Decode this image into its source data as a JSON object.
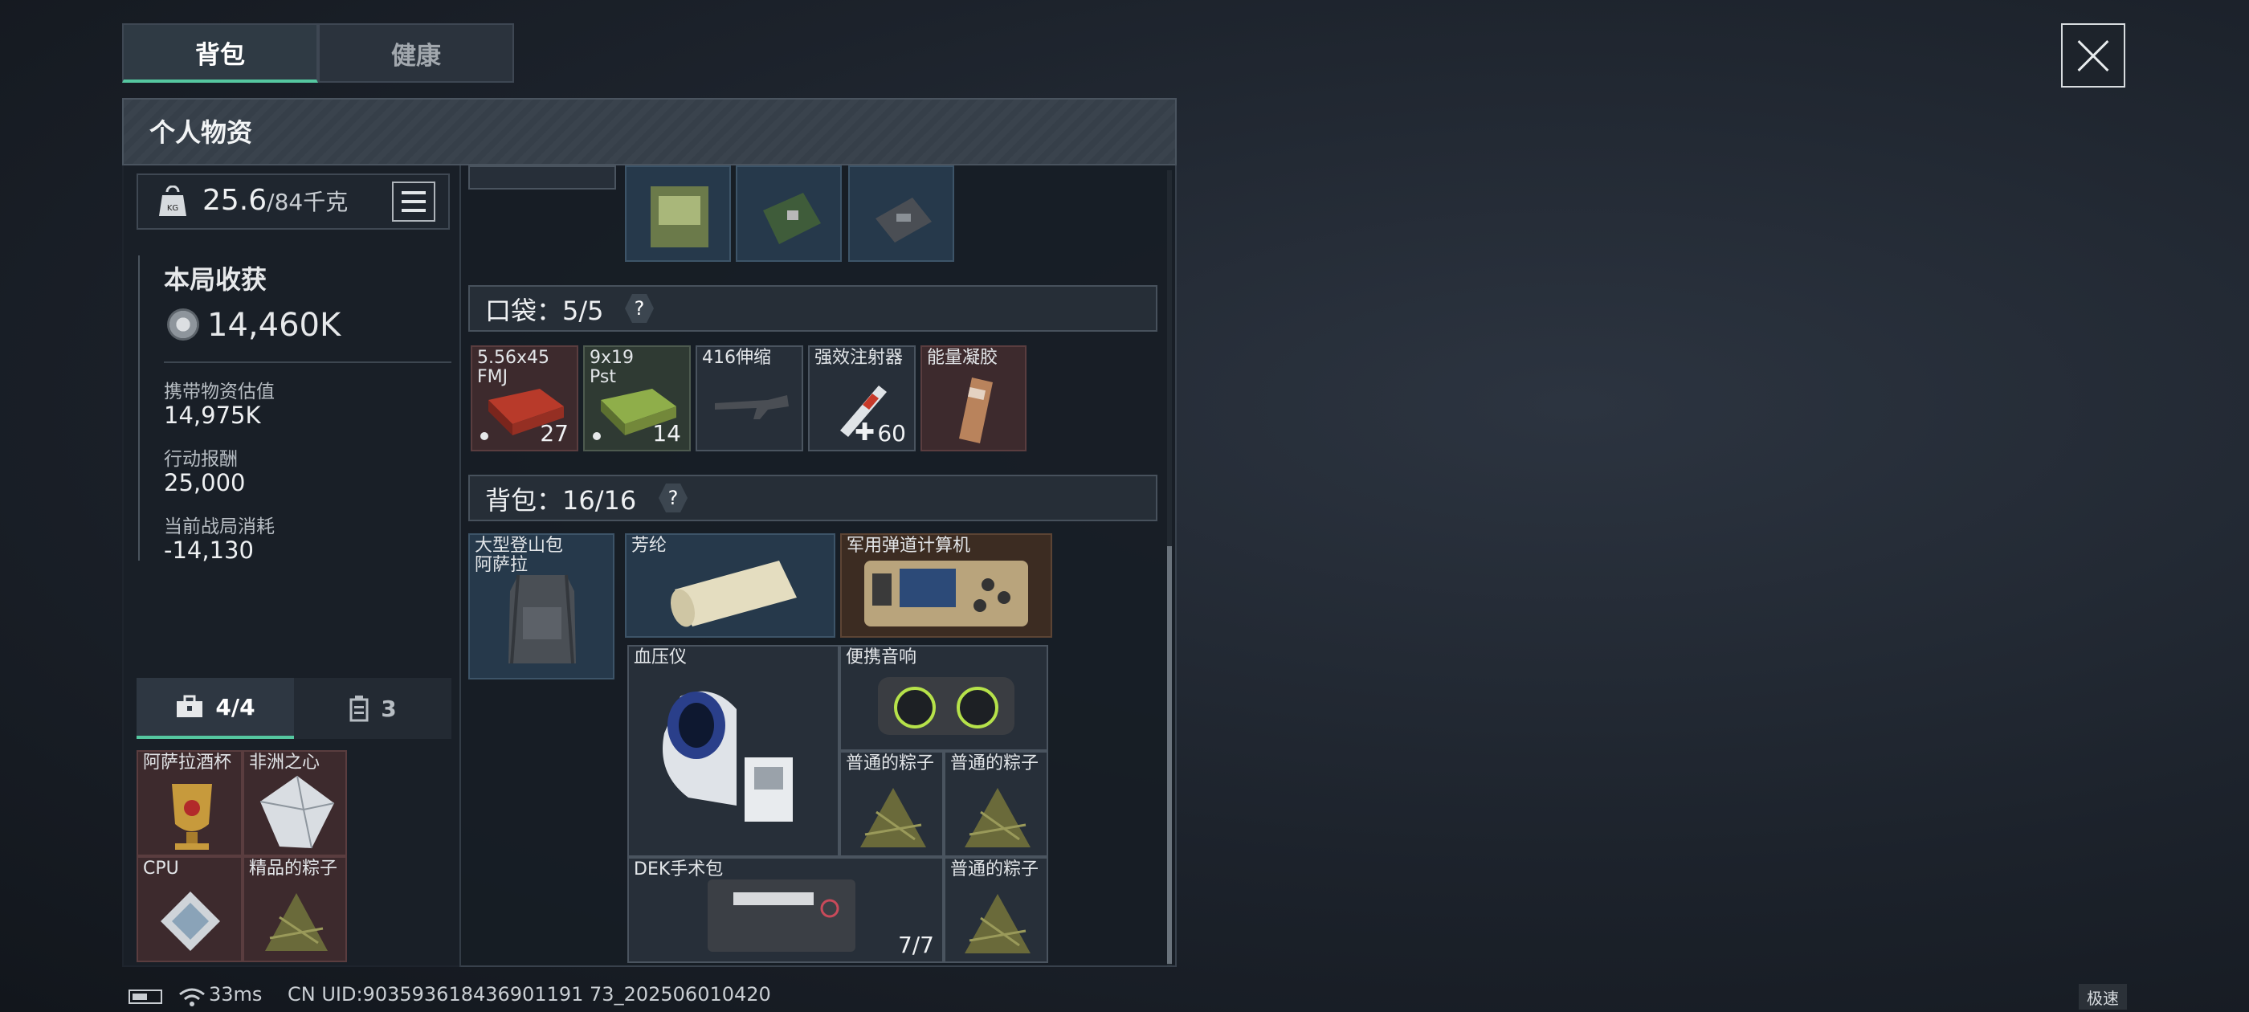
{
  "tabs": {
    "backpack": "背包",
    "health": "健康"
  },
  "panel": {
    "title": "个人物资"
  },
  "weight": {
    "current": "25.6",
    "max": "/84千克"
  },
  "earnings": {
    "title": "本局收获",
    "total": "14,460K",
    "carried_label": "携带物资估值",
    "carried_value": "14,975K",
    "reward_label": "行动报酬",
    "reward_value": "25,000",
    "cost_label": "当前战局消耗",
    "cost_value": "-14,130"
  },
  "subtabs": {
    "safebox": "4/4",
    "other": "3"
  },
  "safebox_items": [
    {
      "label": "阿萨拉酒杯"
    },
    {
      "label": "非洲之心"
    },
    {
      "label": "CPU"
    },
    {
      "label": "精品的粽子"
    }
  ],
  "pockets": {
    "title": "口袋：5/5",
    "items": [
      {
        "label": "5.56x45\nFMJ",
        "count": "27"
      },
      {
        "label": "9x19\nPst",
        "count": "14"
      },
      {
        "label": "416伸缩"
      },
      {
        "label": "强效注射器",
        "count": "60"
      },
      {
        "label": "能量凝胶"
      }
    ]
  },
  "backpack": {
    "title": "背包：16/16",
    "items": [
      {
        "label": "大型登山包\n阿萨拉"
      },
      {
        "label": "芳纶"
      },
      {
        "label": "军用弹道计算机"
      },
      {
        "label": "血压仪"
      },
      {
        "label": "便携音响"
      },
      {
        "label": "普通的粽子"
      },
      {
        "label": "普通的粽子"
      },
      {
        "label": "DEK手术包",
        "count": "7/7"
      },
      {
        "label": "普通的粽子"
      }
    ]
  },
  "status": {
    "ping": "33ms",
    "uid": "CN UID:903593618436901191 73_202506010420",
    "speed_badge": "极速"
  }
}
